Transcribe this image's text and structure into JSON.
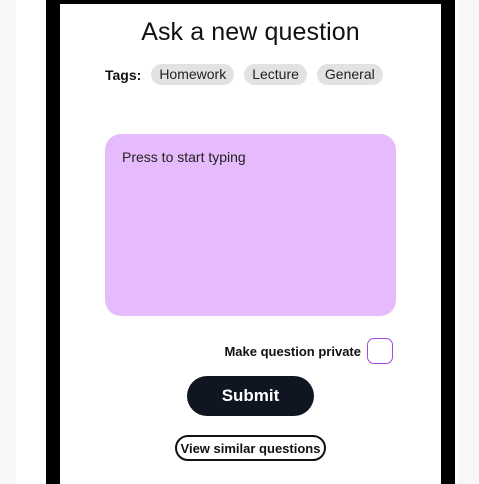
{
  "page": {
    "title": "Ask a new question"
  },
  "tags": {
    "label": "Tags:",
    "items": [
      {
        "label": "Homework"
      },
      {
        "label": "Lecture"
      },
      {
        "label": "General"
      }
    ]
  },
  "question_input": {
    "placeholder": "Press to start typing",
    "value": ""
  },
  "private_option": {
    "label": "Make question private",
    "checked": false
  },
  "actions": {
    "submit_label": "Submit",
    "similar_label": "View similar questions"
  },
  "colors": {
    "input_background": "#e5bbfb",
    "checkbox_border": "#a64ae0",
    "submit_background": "#101522",
    "tag_background": "#e2e2e2"
  }
}
